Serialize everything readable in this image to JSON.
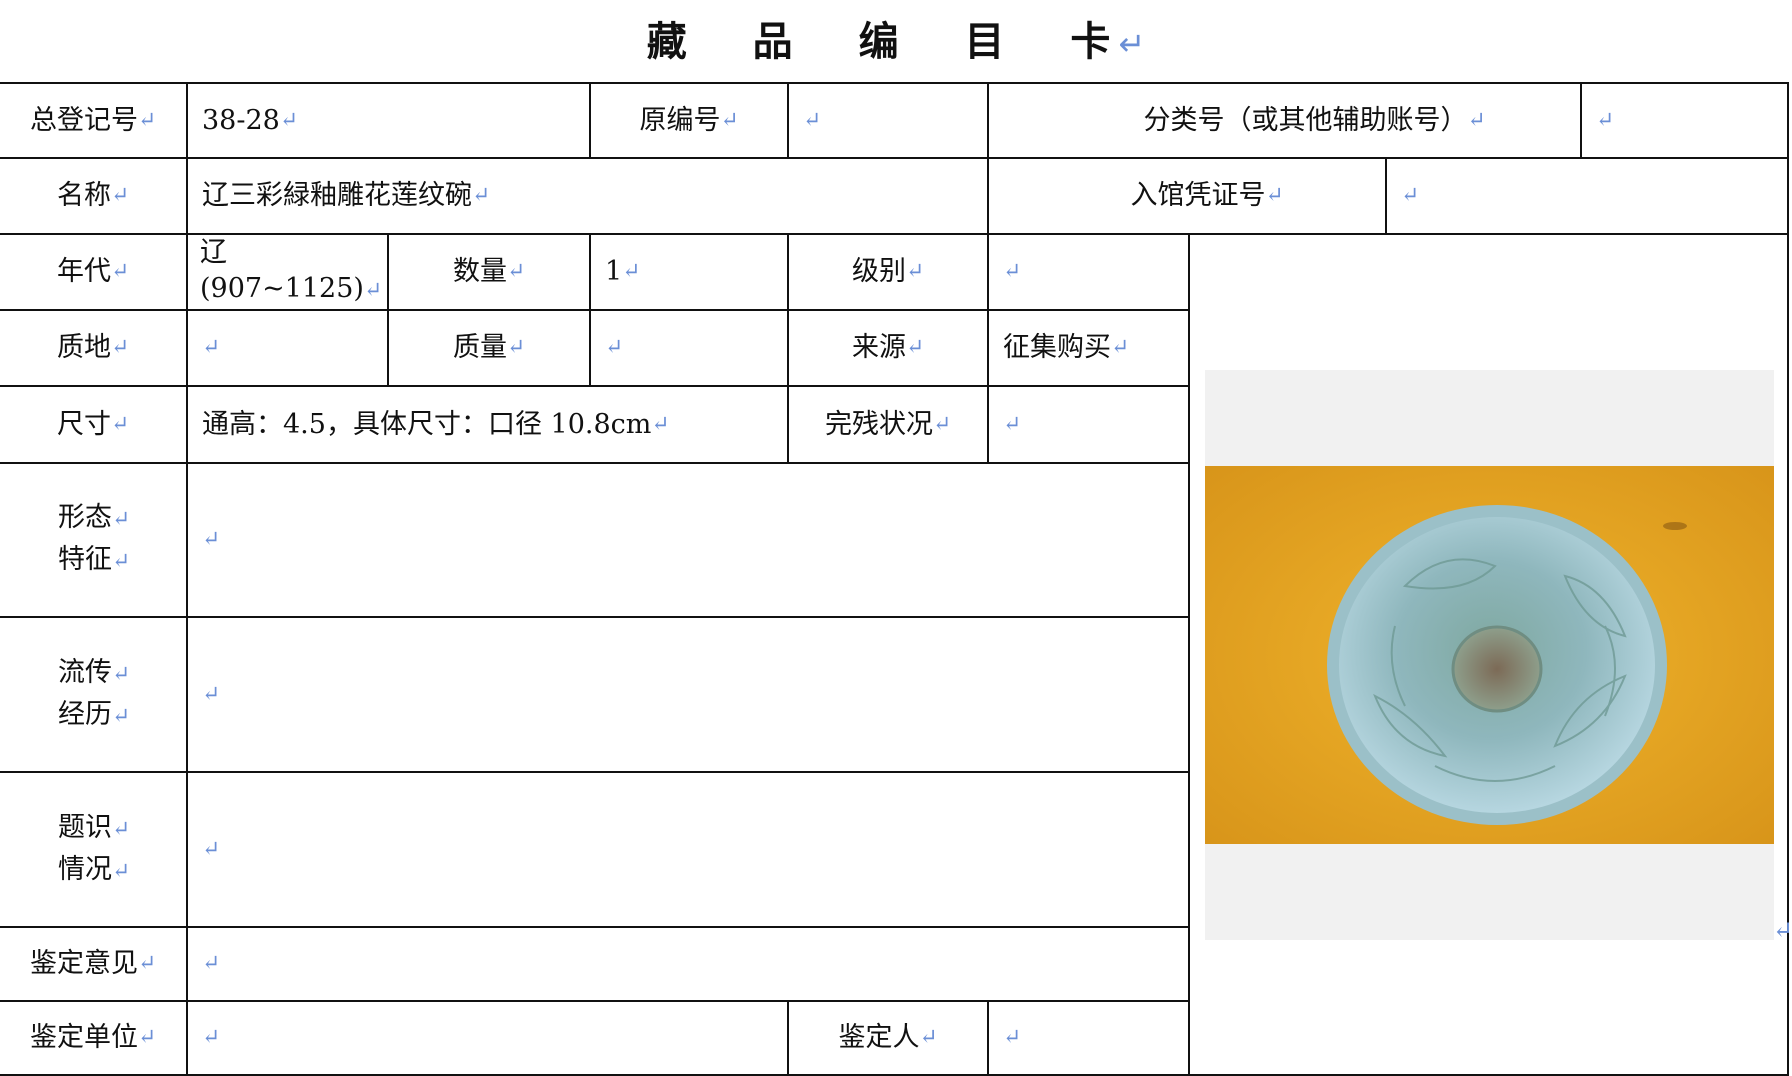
{
  "title": "藏 品 编 目 卡",
  "return_mark": "↵",
  "labels": {
    "registration_no": "总登记号",
    "original_no": "原编号",
    "classification_no": "分类号（或其他辅助账号）",
    "name": "名称",
    "accession_voucher": "入馆凭证号",
    "era": "年代",
    "quantity": "数量",
    "grade": "级别",
    "material": "质地",
    "weight": "质量",
    "source": "来源",
    "dimensions": "尺寸",
    "condition": "完残状况",
    "form_line1": "形态",
    "form_line2": "特征",
    "provenance_line1": "流传",
    "provenance_line2": "经历",
    "inscription_line1": "题识",
    "inscription_line2": "情况",
    "appraisal_opinion": "鉴定意见",
    "appraisal_unit": "鉴定单位",
    "appraiser": "鉴定人"
  },
  "values": {
    "registration_no": "38-28",
    "original_no": "",
    "classification_no": "",
    "name": "辽三彩緑釉雕花莲纹碗",
    "accession_voucher": "",
    "era_line1": "辽",
    "era_line2": "(907~1125)",
    "quantity": "1",
    "grade": "",
    "material": "",
    "weight": "",
    "source": "征集购买",
    "dimensions": "通高：4.5，具体尺寸：口径 10.8cm",
    "condition": "",
    "form": "",
    "provenance": "",
    "inscription": "",
    "appraisal_opinion": "",
    "appraisal_unit": "",
    "appraiser": ""
  },
  "colors": {
    "border": "#111111",
    "return_mark": "#6b8fd6",
    "photo_backdrop": "#e7a521",
    "bowl_glaze": "#9cc3c9"
  }
}
